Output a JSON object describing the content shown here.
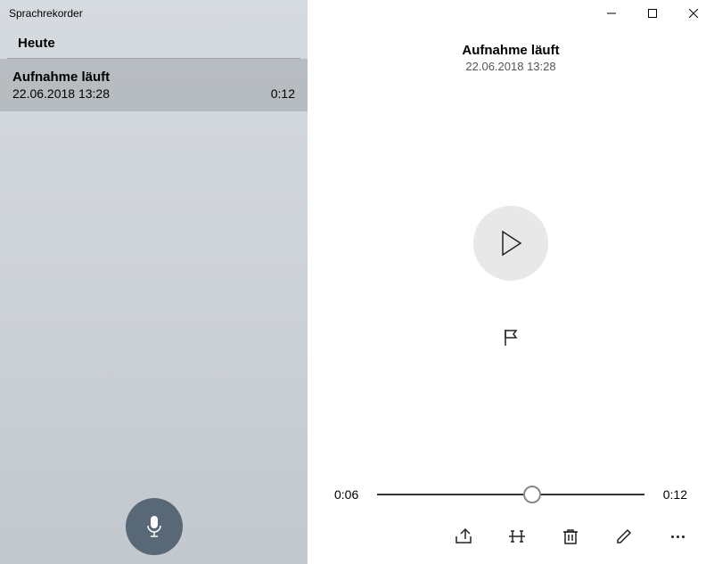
{
  "app_title": "Sprachrekorder",
  "sidebar": {
    "section_header": "Heute",
    "items": [
      {
        "title": "Aufnahme läuft",
        "timestamp": "22.06.2018 13:28",
        "duration": "0:12"
      }
    ]
  },
  "detail": {
    "title": "Aufnahme läuft",
    "timestamp": "22.06.2018 13:28"
  },
  "timeline": {
    "current": "0:06",
    "total": "0:12",
    "progress_percent": 58
  },
  "icons": {
    "microphone": "microphone-icon",
    "play": "play-icon",
    "flag": "flag-icon",
    "share": "share-icon",
    "trim": "trim-icon",
    "delete": "delete-icon",
    "rename": "rename-icon",
    "more": "more-icon",
    "minimize": "minimize-icon",
    "maximize": "maximize-icon",
    "close": "close-icon"
  }
}
